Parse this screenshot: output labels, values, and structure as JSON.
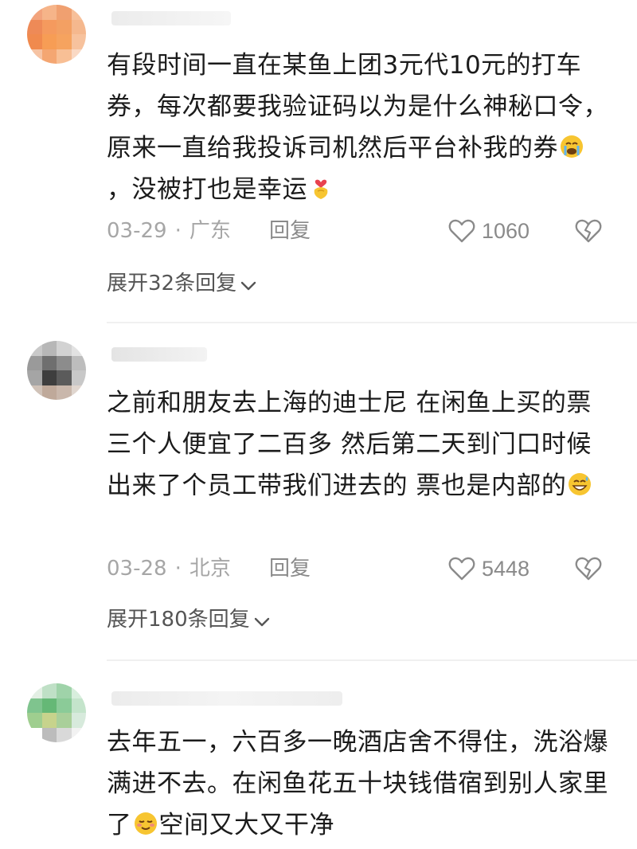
{
  "comments": [
    {
      "text_part1": "有段时间一直在某鱼上团3元代10元的打车券，每次都要我验证码以为是什么神秘口令，原来一直给我投诉司机然后平台补我的券",
      "emoji1": "loudly-crying-face",
      "text_part2": "，没被打也是幸运",
      "emoji2": "heart-hands",
      "date": "03-29",
      "separator": "·",
      "location": "广东",
      "reply_label": "回复",
      "like_count": "1060",
      "expand_label": "展开32条回复"
    },
    {
      "text_part1": "之前和朋友去上海的迪士尼 在闲鱼上买的票 三个人便宜了二百多 然后第二天到门口时候出来了个员工带我们进去的 票也是内部的",
      "emoji1": "grinning-sweat-face",
      "date": "03-28",
      "separator": "·",
      "location": "北京",
      "reply_label": "回复",
      "like_count": "5448",
      "expand_label": "展开180条回复"
    },
    {
      "text_part1": "去年五一，六百多一晚酒店舍不得住，洗浴爆满进不去。在闲鱼花五十块钱借宿到别人家里了",
      "emoji1": "smirking-face",
      "text_part2": "空间又大又干净"
    }
  ],
  "colors": {
    "meta_gray": "#a6a6a6",
    "text_dark": "#1b1b1b",
    "divider": "#f0f0f0",
    "emoji_yellow": "#f7c531"
  }
}
